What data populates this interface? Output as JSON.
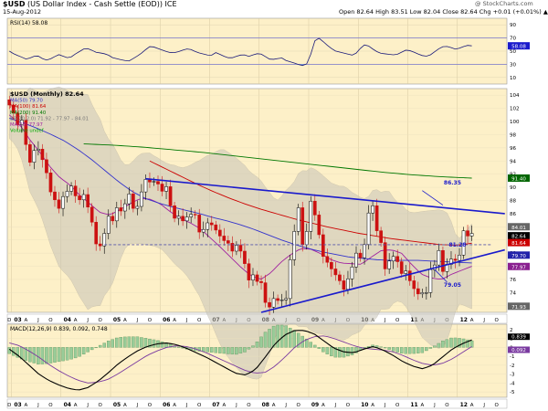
{
  "header": {
    "ticker": "$USD",
    "description": "(US Dollar Index - Cash Settle (EOD)) ICE",
    "date": "15-Aug-2012",
    "quote": "Open 82.64  High 83.51  Low 82.04  Close 82.64  Chg +0.01 (+0.01%) ▲",
    "watermark": "@ StockCharts.com"
  },
  "rsi": {
    "label": "RSI(14) 58.08",
    "value_label": "58.08",
    "ticks": [
      "90",
      "70",
      "50",
      "30",
      "10"
    ]
  },
  "price": {
    "legend": [
      {
        "text": "$USD (Monthly) 82.64",
        "color": "#000000"
      },
      {
        "text": "MA(50) 79.70",
        "color": "#3333cc"
      },
      {
        "text": "MA(100) 81.64",
        "color": "#cc0000"
      },
      {
        "text": "MA(200) 91.40",
        "color": "#007700"
      },
      {
        "text": "BB(20,2.0) 71.92 - 77.97 - 84.01",
        "color": "#777777"
      },
      {
        "text": "MA(20) 77.97",
        "color": "#a020a0"
      },
      {
        "text": "Volume undef",
        "color": "#00aa00"
      }
    ],
    "ticks": [
      "104",
      "102",
      "100",
      "98",
      "96",
      "94",
      "92",
      "90",
      "88",
      "86",
      "84",
      "82",
      "80",
      "78",
      "76",
      "74",
      "72"
    ],
    "right_labels": [
      {
        "text": "91.40",
        "value": 91.4,
        "bg": "#006600"
      },
      {
        "text": "84.01",
        "value": 84.01,
        "bg": "#666666"
      },
      {
        "text": "82.64",
        "value": 82.64,
        "bg": "#000000"
      },
      {
        "text": "81.64",
        "value": 81.64,
        "bg": "#cc0000"
      },
      {
        "text": "79.70",
        "value": 79.7,
        "bg": "#2222aa"
      },
      {
        "text": "77.97",
        "value": 77.97,
        "bg": "#8a2090"
      },
      {
        "text": "71.93",
        "value": 71.93,
        "bg": "#666666"
      }
    ],
    "annotations": [
      "86.35",
      "81.28",
      "79.05"
    ]
  },
  "time_axis": {
    "years": [
      "03",
      "04",
      "05",
      "06",
      "07",
      "08",
      "09",
      "10",
      "11",
      "12",
      "13"
    ],
    "months": [
      "A",
      "J",
      "O"
    ],
    "start_month": "D"
  },
  "macd": {
    "label": "MACD(12,26,9) 0.839, 0.092, 0.748",
    "value_labels": [
      "0.839",
      "0.092"
    ],
    "ticks": [
      "2",
      "1",
      "0",
      "-1",
      "-2",
      "-3",
      "-4",
      "-5"
    ]
  },
  "colors": {
    "panel_bg": "#fdf0c8",
    "up_candle": "#000000",
    "down_candle": "#cc1111",
    "trendline": "#1a1acc",
    "bollinger": "#c8c4b8"
  },
  "chart_data": {
    "type": "candlestick",
    "title": "$USD (US Dollar Index - Cash Settle (EOD)) ICE",
    "period": "Monthly",
    "x_range": [
      "2002-12",
      "2013-01"
    ],
    "ylim": [
      71,
      105
    ],
    "ohlc_monthly_close": [
      102.5,
      101.3,
      99.5,
      100.2,
      96.5,
      93.8,
      95.6,
      95.8,
      94.2,
      92.2,
      89.3,
      88.1,
      86.8,
      88.6,
      89.4,
      90.2,
      88.7,
      88.1,
      88.9,
      87.0,
      84.7,
      81.4,
      81.1,
      83.0,
      85.6,
      84.9,
      86.9,
      86.4,
      87.5,
      89.0,
      86.8,
      87.1,
      89.3,
      91.2,
      90.8,
      90.9,
      90.5,
      89.4,
      90.1,
      87.2,
      85.3,
      85.6,
      84.9,
      85.5,
      85.9,
      85.8,
      83.2,
      83.6,
      84.6,
      84.3,
      83.5,
      82.6,
      81.9,
      81.5,
      80.3,
      81.2,
      80.3,
      78.4,
      75.9,
      76.7,
      75.7,
      75.5,
      72.5,
      71.8,
      73.1,
      72.8,
      72.9,
      73.1,
      79.0,
      83.3,
      86.9,
      81.3,
      83.3,
      87.9,
      85.8,
      82.8,
      79.5,
      78.6,
      77.6,
      76.7,
      75.8,
      74.5,
      76.1,
      77.9,
      80.0,
      79.3,
      81.3,
      86.1,
      87.2,
      83.4,
      81.6,
      77.6,
      78.8,
      79.5,
      78.7,
      76.9,
      77.3,
      75.8,
      74.6,
      73.8,
      74.0,
      74.0,
      77.5,
      78.2,
      80.4,
      77.2,
      78.3,
      79.1,
      78.9,
      79.7,
      83.4,
      82.6,
      83.0
    ],
    "ma50": [
      100.5,
      99.8,
      99.0,
      98.1,
      97.1,
      95.8,
      94.3,
      92.6,
      90.9,
      89.4,
      88.3,
      87.6,
      87.0,
      86.5,
      86.0,
      85.4,
      84.9,
      84.3,
      83.6,
      82.8,
      82.0,
      81.3,
      80.7,
      80.2,
      79.8,
      79.4,
      79.2,
      79.0,
      78.9,
      78.9,
      78.9,
      78.8,
      78.7,
      78.6,
      78.5
    ],
    "ma100": [
      94,
      92.8,
      91.6,
      90.4,
      89.3,
      88.3,
      87.4,
      86.6,
      85.9,
      85.2,
      84.6,
      84.0,
      83.5,
      83.0,
      82.6,
      82.2,
      81.9,
      81.6,
      81.3,
      81.2,
      81.5
    ],
    "ma200": [
      96.6,
      96.4,
      96.1,
      95.7,
      95.3,
      94.8,
      94.3,
      93.8,
      93.3,
      92.8,
      92.3,
      91.9,
      91.6,
      91.4
    ],
    "ma20": [
      101,
      99.6,
      97.3,
      95.4,
      93.2,
      91.5,
      90.4,
      88.8,
      87.5,
      86.2,
      85.8,
      86.6,
      87.5,
      88.3,
      88.2,
      87.5,
      86.3,
      85.3,
      84.6,
      83.7,
      82.3,
      80.9,
      79.4,
      77.9,
      76.6,
      76.0,
      77.0,
      78.6,
      79.8,
      80.7,
      80.6,
      79.9,
      79.0,
      78.5,
      78.4,
      78.3,
      79.4,
      80.4,
      80.5,
      80.0,
      78.3,
      76.8,
      76.2,
      76.0,
      76.8,
      77.4,
      78.0
    ],
    "trendlines": [
      {
        "label": "86.35",
        "from": [
          "2005-09",
          91.3
        ],
        "to": [
          "2012-12",
          86.0
        ]
      },
      {
        "label": "79.05",
        "from": [
          "2008-01",
          71.0
        ],
        "to": [
          "2012-12",
          80.5
        ]
      },
      {
        "label": "81.28",
        "from": [
          "2004-11",
          81.28
        ],
        "to": [
          "2012-09",
          81.28
        ],
        "style": "dashed"
      }
    ],
    "rsi14": [
      50,
      45,
      42,
      38,
      40,
      44,
      39,
      36,
      40,
      45,
      42,
      39,
      45,
      50,
      55,
      52,
      48,
      47,
      45,
      40,
      38,
      36,
      35,
      40,
      45,
      52,
      58,
      55,
      52,
      49,
      47,
      49,
      52,
      54,
      50,
      47,
      45,
      43,
      48,
      44,
      40,
      40,
      43,
      45,
      42,
      45,
      47,
      42,
      37,
      38,
      40,
      35,
      33,
      30,
      28,
      32,
      65,
      70,
      62,
      55,
      50,
      48,
      46,
      44,
      48,
      60,
      58,
      52,
      47,
      46,
      45,
      44,
      48,
      52,
      50,
      46,
      43,
      42,
      48,
      54,
      58,
      56,
      53,
      55,
      59,
      58.08
    ],
    "macd": {
      "macd_line": [
        -0.2,
        -1.0,
        -2.0,
        -3.0,
        -3.7,
        -4.2,
        -4.6,
        -4.8,
        -4.5,
        -3.8,
        -2.9,
        -1.9,
        -1.1,
        -0.4,
        0.1,
        0.4,
        0.5,
        0.3,
        -0.1,
        -0.6,
        -1.1,
        -1.7,
        -2.3,
        -2.9,
        -3.1,
        -2.5,
        -1.1,
        0.4,
        1.4,
        1.9,
        1.9,
        1.5,
        0.7,
        -0.1,
        -0.5,
        -0.6,
        -0.2,
        0.1,
        -0.3,
        -0.9,
        -1.6,
        -2.1,
        -2.4,
        -2.0,
        -1.1,
        -0.2,
        0.4,
        0.839
      ],
      "signal_line": [
        0.5,
        0.2,
        -0.4,
        -1.1,
        -1.9,
        -2.6,
        -3.2,
        -3.7,
        -4.0,
        -3.9,
        -3.6,
        -3.0,
        -2.3,
        -1.6,
        -0.9,
        -0.4,
        0.0,
        0.2,
        0.1,
        -0.2,
        -0.6,
        -1.1,
        -1.6,
        -2.1,
        -2.6,
        -2.9,
        -2.8,
        -2.1,
        -1.1,
        0.0,
        0.8,
        1.2,
        1.3,
        1.0,
        0.6,
        0.2,
        -0.1,
        -0.2,
        -0.3,
        -0.5,
        -0.9,
        -1.4,
        -1.8,
        -2.0,
        -1.8,
        -1.3,
        -0.6,
        0.092
      ]
    }
  }
}
